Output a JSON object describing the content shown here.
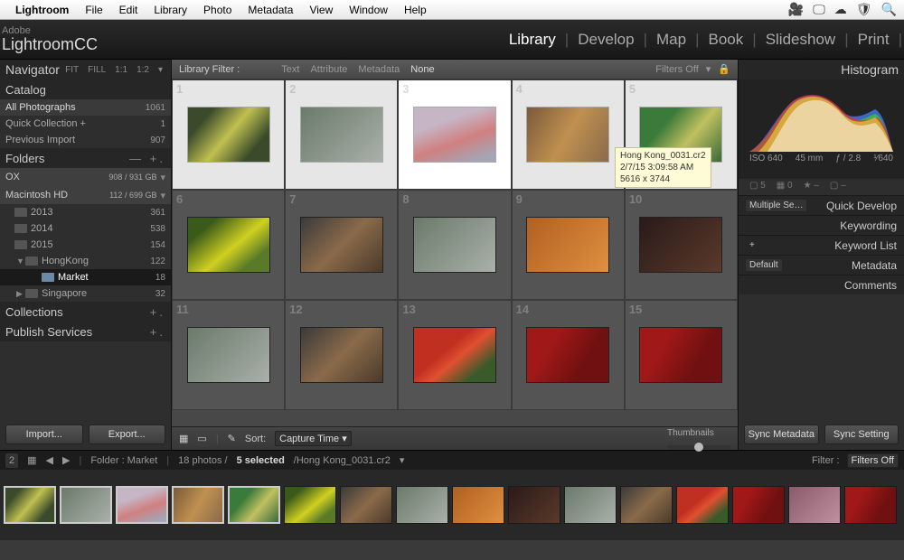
{
  "macmenu": {
    "app": "Lightroom",
    "items": [
      "File",
      "Edit",
      "Library",
      "Photo",
      "Metadata",
      "View",
      "Window",
      "Help"
    ]
  },
  "brand": {
    "vendor": "Adobe",
    "product": "LightroomCC"
  },
  "modules": [
    "Library",
    "Develop",
    "Map",
    "Book",
    "Slideshow",
    "Print"
  ],
  "active_module": "Library",
  "navigator": {
    "title": "Navigator",
    "opts": [
      "FIT",
      "FILL",
      "1:1",
      "1:2"
    ]
  },
  "catalog": {
    "title": "Catalog",
    "items": [
      {
        "label": "All Photographs",
        "count": 1061
      },
      {
        "label": "Quick Collection  +",
        "count": 1
      },
      {
        "label": "Previous Import",
        "count": 907
      }
    ]
  },
  "folders": {
    "title": "Folders",
    "drives": [
      {
        "name": "OX",
        "usage": "908 / 931 GB"
      },
      {
        "name": "Macintosh HD",
        "usage": "112 / 699 GB"
      }
    ],
    "tree": [
      {
        "name": "2013",
        "count": 361,
        "depth": 1
      },
      {
        "name": "2014",
        "count": 538,
        "depth": 1
      },
      {
        "name": "2015",
        "count": 154,
        "depth": 1,
        "open": true
      },
      {
        "name": "HongKong",
        "count": 122,
        "depth": 2,
        "open": true
      },
      {
        "name": "Market",
        "count": 18,
        "depth": 3,
        "selected": true
      },
      {
        "name": "Singapore",
        "count": 32,
        "depth": 2
      }
    ]
  },
  "collections": {
    "title": "Collections"
  },
  "publish": {
    "title": "Publish Services"
  },
  "buttons": {
    "import": "Import...",
    "export": "Export..."
  },
  "filterbar": {
    "label": "Library Filter :",
    "items": [
      "Text",
      "Attribute",
      "Metadata",
      "None"
    ],
    "active": "None",
    "filters_off": "Filters Off"
  },
  "tooltip": {
    "line1": "Hong Kong_0031.cr2",
    "line2": "2/7/15 3:09:58 AM",
    "line3": "5616 x 3744"
  },
  "toolbar2": {
    "sort_label": "Sort:",
    "sort_value": "Capture Time",
    "thumb_label": "Thumbnails"
  },
  "histogram": {
    "title": "Histogram",
    "info": {
      "iso": "ISO 640",
      "focal": "45 mm",
      "aperture": "ƒ / 2.8",
      "tv": "¹⁄640"
    },
    "flags": {
      "box": "5",
      "squ": "0",
      "star": "–",
      "tag": "–"
    },
    "panels": [
      {
        "left": "Multiple Se…",
        "label": "Quick Develop"
      },
      {
        "left": "",
        "label": "Keywording"
      },
      {
        "left": "+",
        "label": "Keyword List"
      },
      {
        "left": "Default",
        "label": "Metadata"
      },
      {
        "left": "",
        "label": "Comments"
      }
    ]
  },
  "rightbuttons": {
    "sync_meta": "Sync Metadata",
    "sync_set": "Sync Setting"
  },
  "status": {
    "breadcrumb": "Folder : Market",
    "count_label": "18 photos /",
    "selected": "5 selected",
    "filename": "/Hong Kong_0031.cr2",
    "filter_label": "Filter :",
    "filter_val": "Filters Off"
  }
}
